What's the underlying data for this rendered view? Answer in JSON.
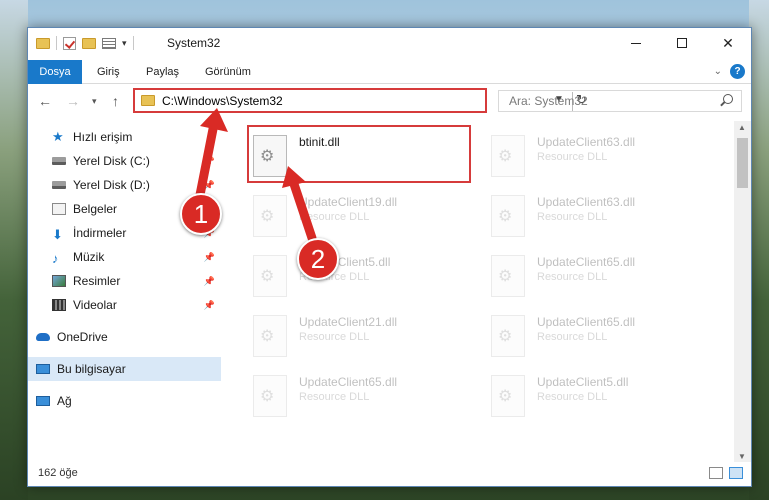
{
  "window": {
    "title": "System32"
  },
  "ribbon": {
    "tabs": [
      "Dosya",
      "Giriş",
      "Paylaş",
      "Görünüm"
    ],
    "help_label": "?"
  },
  "address": {
    "path": "C:\\Windows\\System32",
    "search_placeholder": "Ara: System32"
  },
  "nav": {
    "items": [
      {
        "label": "Hızlı erişim",
        "icon": "star-icon"
      },
      {
        "label": "Yerel Disk (C:)",
        "icon": "drive-icon",
        "pinned": true
      },
      {
        "label": "Yerel Disk (D:)",
        "icon": "drive-icon",
        "pinned": true
      },
      {
        "label": "Belgeler",
        "icon": "documents-icon",
        "pinned": true
      },
      {
        "label": "İndirmeler",
        "icon": "download-icon",
        "pinned": true
      },
      {
        "label": "Müzik",
        "icon": "music-icon",
        "pinned": true
      },
      {
        "label": "Resimler",
        "icon": "pictures-icon",
        "pinned": true
      },
      {
        "label": "Videolar",
        "icon": "videos-icon",
        "pinned": true
      },
      {
        "label": "OneDrive",
        "icon": "onedrive-icon"
      },
      {
        "label": "Bu bilgisayar",
        "icon": "this-pc-icon",
        "selected": true
      },
      {
        "label": "Ağ",
        "icon": "network-icon"
      }
    ]
  },
  "files": [
    {
      "name": "btinit.dll",
      "type": ""
    },
    {
      "name": "UpdateClient63.dll",
      "type": "Resource DLL"
    },
    {
      "name": "UpdateClient19.dll",
      "type": "Resource DLL"
    },
    {
      "name": "UpdateClient63.dll",
      "type": "Resource DLL"
    },
    {
      "name": "UpdateClient5.dll",
      "type": "Resource DLL"
    },
    {
      "name": "UpdateClient65.dll",
      "type": "Resource DLL"
    },
    {
      "name": "UpdateClient21.dll",
      "type": "Resource DLL"
    },
    {
      "name": "UpdateClient65.dll",
      "type": "Resource DLL"
    },
    {
      "name": "UpdateClient65.dll",
      "type": "Resource DLL"
    },
    {
      "name": "UpdateClient5.dll",
      "type": "Resource DLL"
    }
  ],
  "status": {
    "item_count": "162 öğe"
  },
  "annotations": {
    "step1": "1",
    "step2": "2",
    "color": "#d92a25"
  }
}
